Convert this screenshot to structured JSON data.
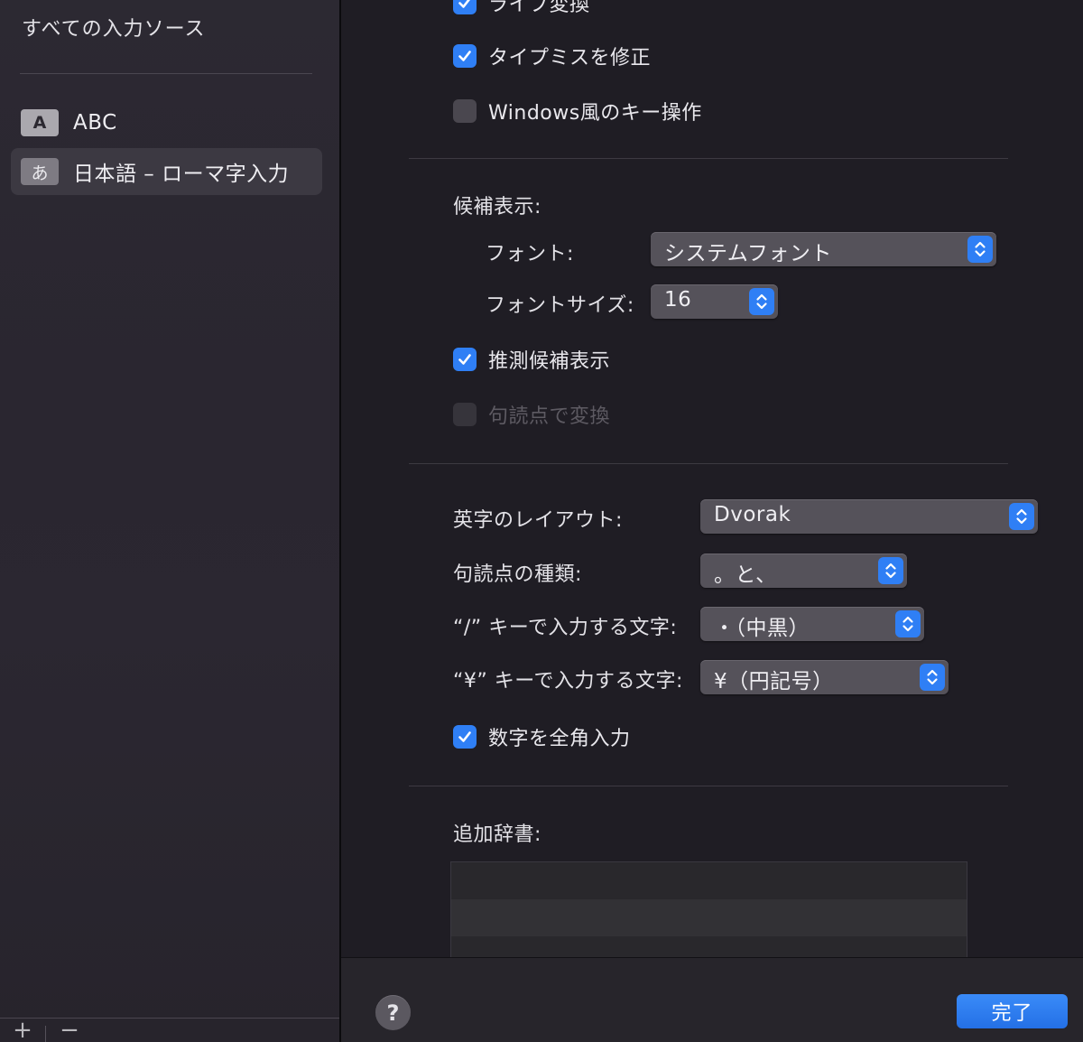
{
  "sidebar": {
    "heading": "すべての入力ソース",
    "sources": [
      {
        "badge": "A",
        "label": "ABC",
        "selected": false
      },
      {
        "badge": "あ",
        "label": "日本語 – ローマ字入力",
        "selected": true
      }
    ],
    "add_symbol": "+",
    "remove_symbol": "−"
  },
  "options": {
    "live_conversion": {
      "label": "ライブ変換",
      "checked": true
    },
    "typo_correction": {
      "label": "タイプミスを修正",
      "checked": true
    },
    "windows_keys": {
      "label": "Windows風のキー操作",
      "checked": false
    }
  },
  "candidates": {
    "heading": "候補表示:",
    "font_label": "フォント:",
    "font_value": "システムフォント",
    "font_size_label": "フォントサイズ:",
    "font_size_value": "16",
    "predictive": {
      "label": "推測候補表示",
      "checked": true
    },
    "punctuation_convert": {
      "label": "句読点で変換",
      "checked": false,
      "enabled": false
    }
  },
  "layout": {
    "english_layout_label": "英字のレイアウト:",
    "english_layout_value": "Dvorak",
    "punctuation_type_label": "句読点の種類:",
    "punctuation_type_value": "。と、",
    "slash_key_label": "“/” キーで入力する文字:",
    "slash_key_value": "・（中黒）",
    "yen_key_label": "“¥” キーで入力する文字:",
    "yen_key_value": "¥（円記号）",
    "fullwidth_numbers": {
      "label": "数字を全角入力",
      "checked": true
    }
  },
  "dictionary": {
    "heading": "追加辞書:"
  },
  "footer": {
    "help_symbol": "?",
    "done_label": "完了"
  },
  "colors": {
    "accent": "#2f7ff5",
    "background": "#1f1d24",
    "sidebar": "#2b2731"
  }
}
